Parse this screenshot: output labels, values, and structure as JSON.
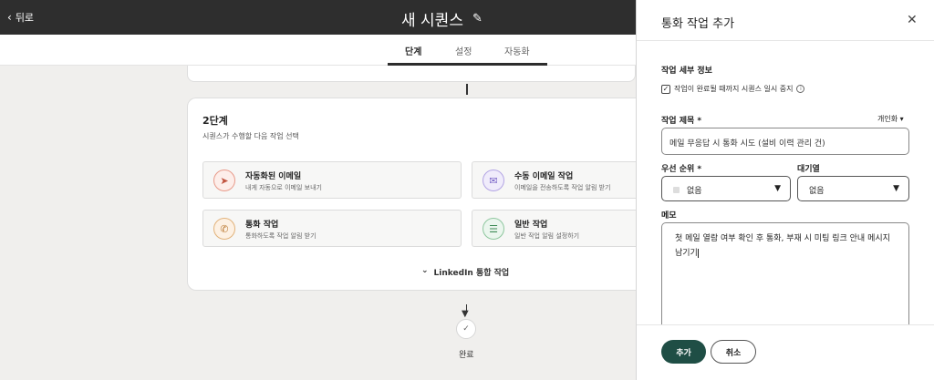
{
  "topbar": {
    "back_label": "뒤로",
    "title": "새 시퀀스"
  },
  "tabs": [
    {
      "label": "단계",
      "active": true
    },
    {
      "label": "설정",
      "active": false
    },
    {
      "label": "자동화",
      "active": false
    }
  ],
  "step": {
    "title": "2단계",
    "subtitle": "시퀀스가 수행할 다음 작업 선택",
    "actions": [
      {
        "title": "자동화된 이메일",
        "desc": "내게 자동으로 이메일 보내기",
        "icon": "paper-plane-icon",
        "color": "#c0533e"
      },
      {
        "title": "수동 이메일 작업",
        "desc": "이메일을 전송하도록 작업 알림 받기",
        "icon": "envelope-icon",
        "color": "#7762c6"
      },
      {
        "title": "통화 작업",
        "desc": "통화하도록 작업 알림 받기",
        "icon": "phone-icon",
        "color": "#b9772f"
      },
      {
        "title": "일반 작업",
        "desc": "일반 작업 알림 설정하기",
        "icon": "checklist-icon",
        "color": "#3f8b56"
      }
    ],
    "linkedin_label": "LinkedIn 통합 작업"
  },
  "done_label": "완료",
  "panel": {
    "title": "통화 작업 추가",
    "section_label": "작업 세부 정보",
    "pause_checkbox": {
      "label": "작업이 완료될 때까지 시퀀스 일시 중지",
      "checked": true
    },
    "task_title_label": "작업 제목 *",
    "personalize_label": "개인화",
    "task_title_value": "메일 무응답 시 통화 시도 (설비 이력 관리 건)",
    "priority_label": "우선 순위 *",
    "priority_value": "없음",
    "queue_label": "대기열",
    "queue_value": "없음",
    "notes_label": "메모",
    "notes_value": "첫 메일 열람 여부 확인 후 통화, 부재 시 미팅 링크 안내 메시지 남기기",
    "add_button": "추가",
    "cancel_button": "취소"
  },
  "colors": {
    "primary": "#1f4e45",
    "topbar": "#2e2e2e"
  }
}
